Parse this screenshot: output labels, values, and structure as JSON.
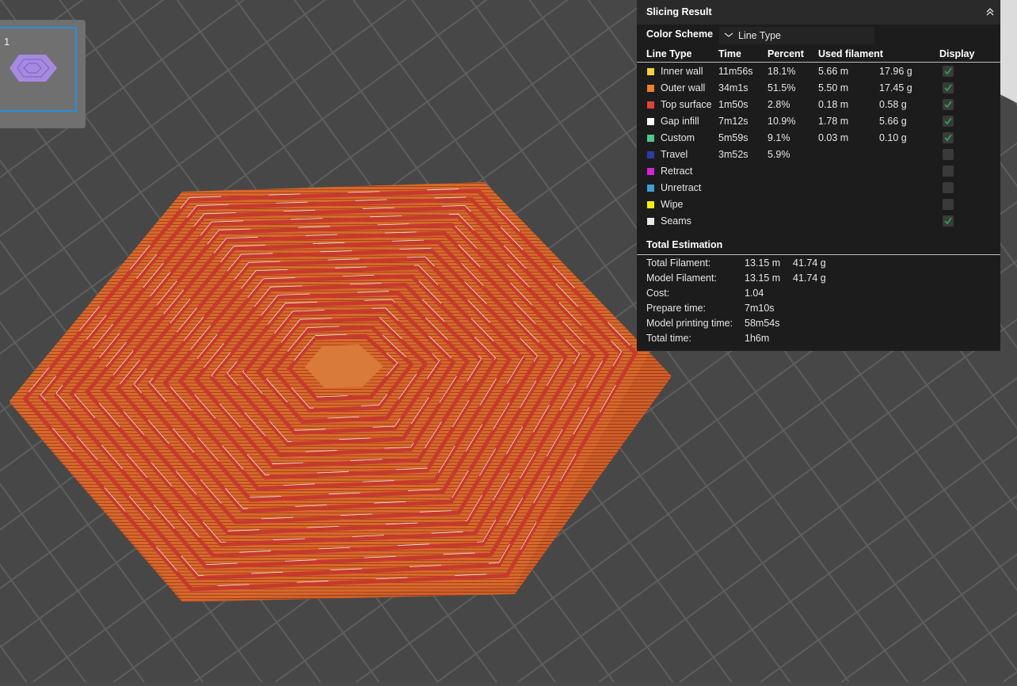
{
  "plate": {
    "number": "1"
  },
  "panel": {
    "title": "Slicing Result",
    "color_scheme_label": "Color Scheme",
    "color_scheme_value": "Line Type",
    "headers": {
      "line_type": "Line Type",
      "time": "Time",
      "percent": "Percent",
      "used_filament": "Used filament",
      "display": "Display"
    },
    "rows": [
      {
        "color": "#f5d234",
        "name": "Inner wall",
        "time": "11m56s",
        "percent": "18.1%",
        "length": "5.66 m",
        "weight": "17.96 g",
        "display": true
      },
      {
        "color": "#f07f2f",
        "name": "Outer wall",
        "time": "34m1s",
        "percent": "51.5%",
        "length": "5.50 m",
        "weight": "17.45 g",
        "display": true
      },
      {
        "color": "#e5403a",
        "name": "Top surface",
        "time": "1m50s",
        "percent": "2.8%",
        "length": "0.18 m",
        "weight": "0.58 g",
        "display": true
      },
      {
        "color": "#ffffff",
        "name": "Gap infill",
        "time": "7m12s",
        "percent": "10.9%",
        "length": "1.78 m",
        "weight": "5.66 g",
        "display": true
      },
      {
        "color": "#4dc98a",
        "name": "Custom",
        "time": "5m59s",
        "percent": "9.1%",
        "length": "0.03 m",
        "weight": "0.10 g",
        "display": true
      },
      {
        "color": "#2c3da6",
        "name": "Travel",
        "time": "3m52s",
        "percent": "5.9%",
        "length": "",
        "weight": "",
        "display": false
      },
      {
        "color": "#d623d6",
        "name": "Retract",
        "time": "",
        "percent": "",
        "length": "",
        "weight": "",
        "display": false
      },
      {
        "color": "#3aa0d6",
        "name": "Unretract",
        "time": "",
        "percent": "",
        "length": "",
        "weight": "",
        "display": false
      },
      {
        "color": "#f5f000",
        "name": "Wipe",
        "time": "",
        "percent": "",
        "length": "",
        "weight": "",
        "display": false
      },
      {
        "color": "#e8e8e8",
        "name": "Seams",
        "time": "",
        "percent": "",
        "length": "",
        "weight": "",
        "display": true
      }
    ],
    "total_title": "Total Estimation",
    "totals": [
      {
        "label": "Total Filament:",
        "value": "13.15 m",
        "extra": "41.74 g"
      },
      {
        "label": "Model Filament:",
        "value": "13.15 m",
        "extra": "41.74 g"
      },
      {
        "label": "Cost:",
        "value": "1.04",
        "extra": ""
      },
      {
        "label": "Prepare time:",
        "value": "7m10s",
        "extra": ""
      },
      {
        "label": "Model printing time:",
        "value": "58m54s",
        "extra": ""
      },
      {
        "label": "Total time:",
        "value": "1h6m",
        "extra": ""
      }
    ]
  },
  "colors": {
    "model_orange": "#d86a2a",
    "model_red": "#c63a2e",
    "plate_grid": "#4a4a4a",
    "check_green": "#2f9e55",
    "accent_blue": "#2a8fd6",
    "thumb_purple": "#9a7fd6"
  }
}
